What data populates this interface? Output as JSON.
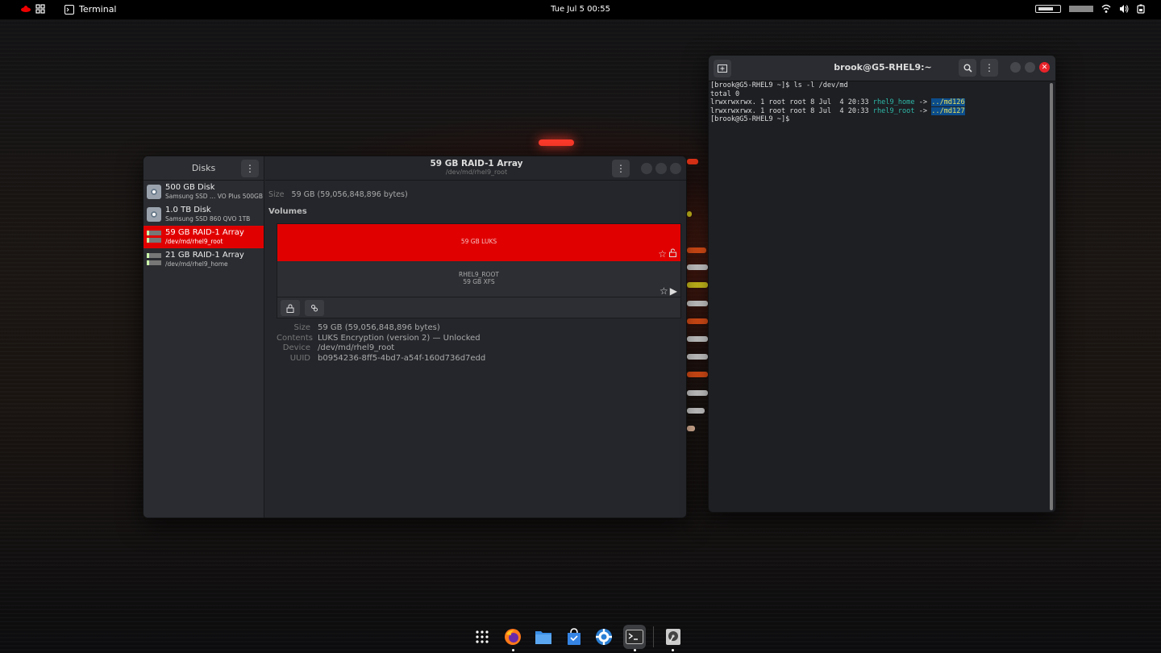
{
  "topbar": {
    "app_name": "Terminal",
    "clock": "Tue Jul 5  00:55"
  },
  "disks": {
    "sidebar_title": "Disks",
    "drives": [
      {
        "name": "500 GB Disk",
        "sub": "Samsung SSD …  VO Plus 500GB",
        "icon": "disk-icon",
        "selected": false
      },
      {
        "name": "1.0 TB Disk",
        "sub": "Samsung SSD 860 QVO 1TB",
        "icon": "disk-icon",
        "selected": false
      },
      {
        "name": "59 GB RAID-1 Array",
        "sub": "/dev/md/rhel9_root",
        "icon": "raid-icon",
        "selected": true
      },
      {
        "name": "21 GB RAID-1 Array",
        "sub": "/dev/md/rhel9_home",
        "icon": "raid-icon",
        "selected": false
      }
    ],
    "title": "59 GB RAID-1 Array",
    "subtitle": "/dev/md/rhel9_root",
    "size_label": "Size",
    "size_value": "59 GB (59,056,848,896 bytes)",
    "volumes_label": "Volumes",
    "volumes": [
      {
        "line1": "59 GB LUKS",
        "line2": ""
      },
      {
        "line1": "RHEL9_ROOT",
        "line2": "59 GB XFS"
      }
    ],
    "properties": [
      {
        "key": "Size",
        "value": "59 GB (59,056,848,896 bytes)"
      },
      {
        "key": "Contents",
        "value": "LUKS Encryption (version 2) — Unlocked"
      },
      {
        "key": "Device",
        "value": "/dev/md/rhel9_root"
      },
      {
        "key": "UUID",
        "value": "b0954236-8ff5-4bd7-a54f-160d736d7edd"
      }
    ]
  },
  "terminal": {
    "title": "brook@G5-RHEL9:~",
    "lines": {
      "cmd": "[brook@G5-RHEL9 ~]$ ls -l /dev/md",
      "total": "total 0",
      "l1_prefix": "lrwxrwxrwx. 1 root root 8 Jul  4 20:33 ",
      "l1_name": "rhel9_home",
      "l1_arrow": " -> ",
      "l1_target": "../md126",
      "l2_prefix": "lrwxrwxrwx. 1 root root 8 Jul  4 20:33 ",
      "l2_name": "rhel9_root",
      "l2_arrow": " -> ",
      "l2_target": "../md127",
      "prompt": "[brook@G5-RHEL9 ~]$ "
    }
  },
  "dock": {
    "items": [
      "app-grid-icon",
      "firefox-icon",
      "files-icon",
      "software-icon",
      "help-icon",
      "terminal-icon",
      "disks-icon"
    ]
  },
  "colors": {
    "accent_red": "#e00000",
    "close_red": "#e8232a",
    "term_link": "#2fb8a8",
    "term_dir_fg": "#e6e060",
    "term_dir_bg": "#0c4d8c"
  }
}
